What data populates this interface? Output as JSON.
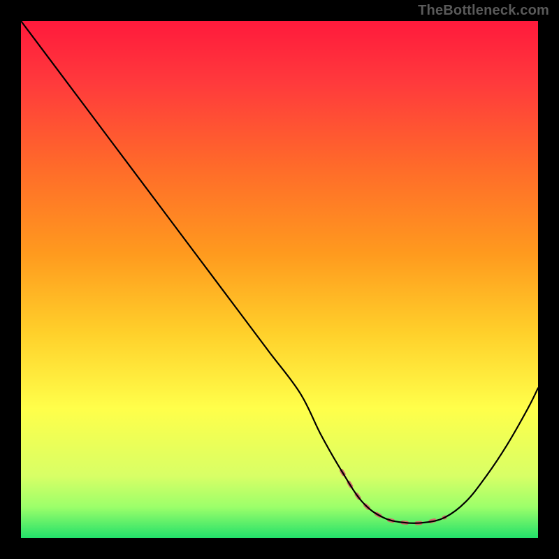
{
  "watermark": "TheBottleneck.com",
  "chart_data": {
    "type": "line",
    "title": "",
    "xlabel": "",
    "ylabel": "",
    "xlim": [
      0,
      100
    ],
    "ylim": [
      0,
      100
    ],
    "grid": false,
    "legend": false,
    "gradient_stops": [
      {
        "offset": 0,
        "color": "#ff1a3c"
      },
      {
        "offset": 12,
        "color": "#ff3a3c"
      },
      {
        "offset": 28,
        "color": "#ff6a2a"
      },
      {
        "offset": 45,
        "color": "#ff9a1e"
      },
      {
        "offset": 60,
        "color": "#ffcf2a"
      },
      {
        "offset": 75,
        "color": "#ffff4a"
      },
      {
        "offset": 88,
        "color": "#d8ff66"
      },
      {
        "offset": 94,
        "color": "#9cff6a"
      },
      {
        "offset": 100,
        "color": "#22e06a"
      }
    ],
    "series": [
      {
        "name": "bottleneck-curve",
        "color": "#000000",
        "width": 2.2,
        "x": [
          0,
          6,
          12,
          18,
          24,
          30,
          36,
          42,
          48,
          54,
          58,
          62,
          66,
          70,
          74,
          78,
          82,
          86,
          90,
          94,
          98,
          100
        ],
        "y": [
          100,
          92,
          84,
          76,
          68,
          60,
          52,
          44,
          36,
          28,
          20,
          13,
          7,
          4,
          3,
          3,
          4,
          7,
          12,
          18,
          25,
          29
        ]
      },
      {
        "name": "highlight-band",
        "color": "#d16a6a",
        "width": 5.5,
        "x": [
          62,
          66,
          70,
          74,
          78,
          82
        ],
        "y": [
          13,
          7,
          4,
          3,
          3,
          4
        ]
      }
    ]
  }
}
